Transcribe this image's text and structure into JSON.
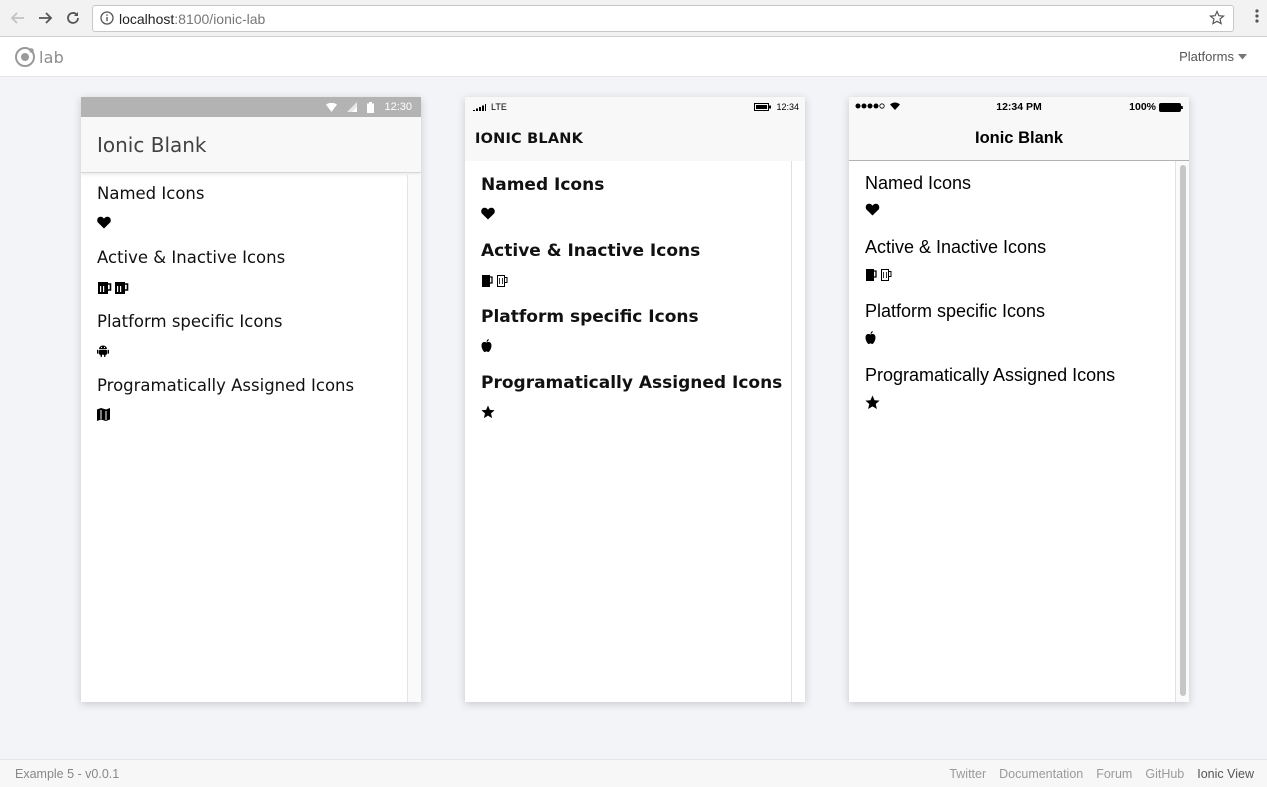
{
  "browser": {
    "url_host": "localhost",
    "url_rest": ":8100/ionic-lab"
  },
  "lab": {
    "logo_text": "lab",
    "platforms_label": "Platforms"
  },
  "android": {
    "status_time": "12:30",
    "title": "Ionic Blank",
    "sections": [
      {
        "heading": "Named Icons",
        "icon": "heart-icon"
      },
      {
        "heading": "Active & Inactive Icons",
        "icon": "beer-icon"
      },
      {
        "heading": "Platform specific Icons",
        "icon": "android-icon"
      },
      {
        "heading": "Programatically Assigned Icons",
        "icon": "map-icon"
      }
    ]
  },
  "windows": {
    "status_network": "LTE",
    "status_time": "12:34",
    "title": "IONIC BLANK",
    "sections": [
      {
        "heading": "Named Icons",
        "icon": "heart-icon"
      },
      {
        "heading": "Active & Inactive Icons",
        "icon": "beer-icon"
      },
      {
        "heading": "Platform specific Icons",
        "icon": "apple-icon"
      },
      {
        "heading": "Programatically Assigned Icons",
        "icon": "star-icon"
      }
    ]
  },
  "ios": {
    "status_time": "12:34 PM",
    "status_battery": "100%",
    "title": "Ionic Blank",
    "sections": [
      {
        "heading": "Named Icons",
        "icon": "heart-icon"
      },
      {
        "heading": "Active & Inactive Icons",
        "icon": "beer-icon"
      },
      {
        "heading": "Platform specific Icons",
        "icon": "apple-icon"
      },
      {
        "heading": "Programatically Assigned Icons",
        "icon": "star-icon"
      }
    ]
  },
  "footer": {
    "version": "Example 5 - v0.0.1",
    "links": [
      "Twitter",
      "Documentation",
      "Forum",
      "GitHub",
      "Ionic View"
    ]
  }
}
